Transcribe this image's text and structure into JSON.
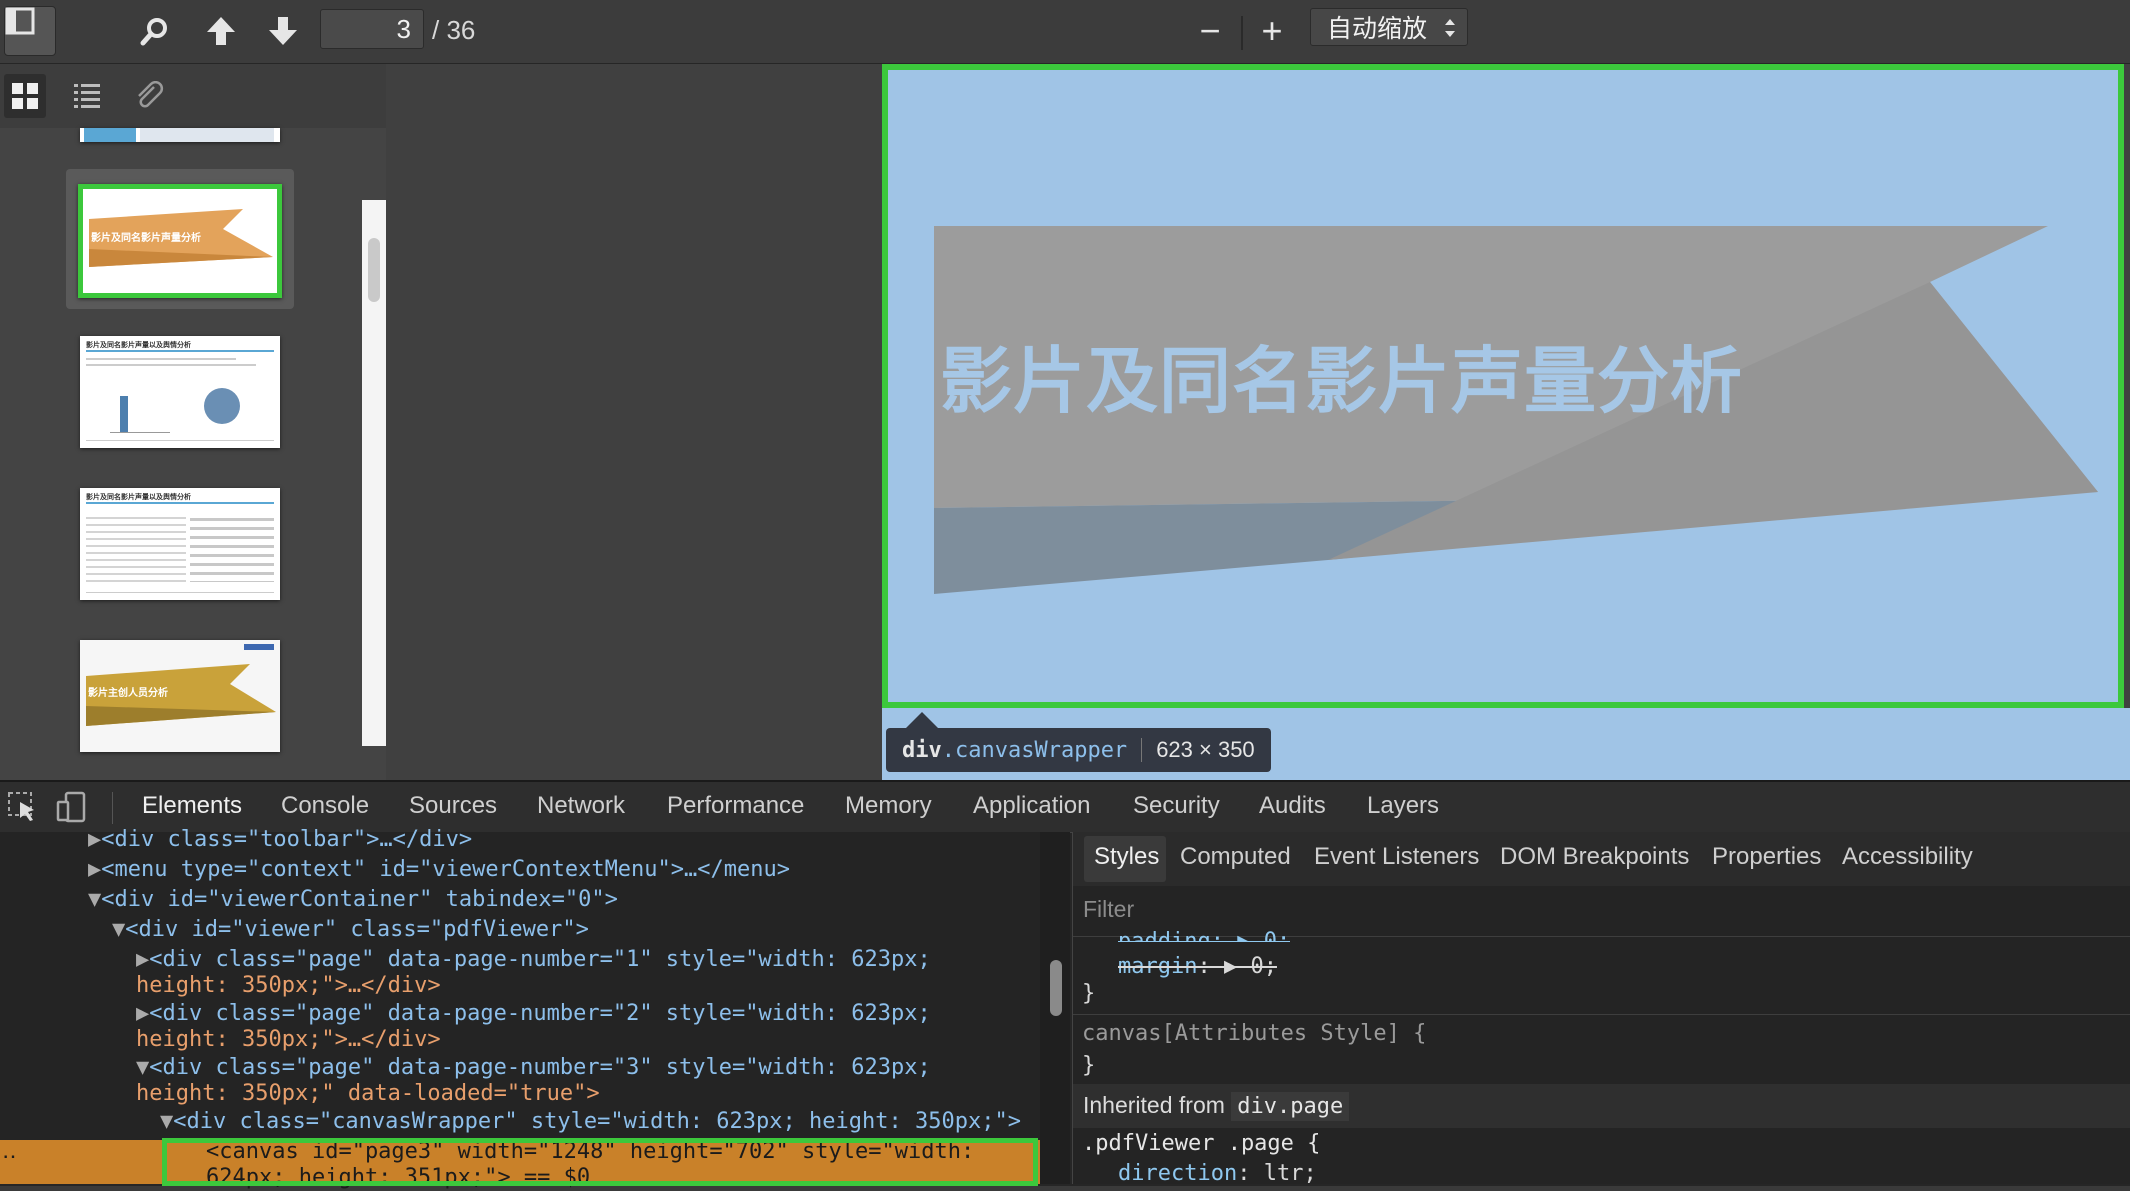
{
  "toolbar": {
    "page_number": "3",
    "page_total": "/ 36",
    "zoom_label": "自动缩放",
    "zoom_out": "−",
    "zoom_in": "+"
  },
  "thumbnails": [
    {
      "title": "影片及同名影片声量分析"
    },
    {
      "title": "影片及同名影片声量以及舆情分析"
    },
    {
      "title": "影片及同名影片声量以及舆情分析"
    },
    {
      "title": "影片主创人员分析"
    }
  ],
  "slide": {
    "title": "影片及同名影片声量分析"
  },
  "tooltip": {
    "selector_tag": "div",
    "selector_class": ".canvasWrapper",
    "size": "623 × 350"
  },
  "devtools": {
    "tabs": [
      "Elements",
      "Console",
      "Sources",
      "Network",
      "Performance",
      "Memory",
      "Application",
      "Security",
      "Audits",
      "Layers"
    ],
    "dom_lines": [
      "<div class=\"toolbar\">…</div>",
      "<menu type=\"context\" id=\"viewerContextMenu\">…</menu>",
      "<div id=\"viewerContainer\" tabindex=\"0\">",
      "<div id=\"viewer\" class=\"pdfViewer\">",
      "<div class=\"page\" data-page-number=\"1\" style=\"width: 623px;",
      "height: 350px;\">…</div>",
      "<div class=\"page\" data-page-number=\"2\" style=\"width: 623px;",
      "height: 350px;\">…</div>",
      "<div class=\"page\" data-page-number=\"3\" style=\"width: 623px;",
      "height: 350px;\" data-loaded=\"true\">",
      "<div class=\"canvasWrapper\" style=\"width: 623px; height: 350px;\">",
      "<canvas id=\"page3\" width=\"1248\" height=\"702\" style=\"width:",
      "624px; height: 351px;\"> == $0"
    ],
    "styles_tabs": [
      "Styles",
      "Computed",
      "Event Listeners",
      "DOM Breakpoints",
      "Properties",
      "Accessibility"
    ],
    "filter_placeholder": "Filter",
    "css_lines": {
      "padding": "padding: ▶ 0;",
      "margin_prop": "margin",
      "margin_val": ": ▶ 0;",
      "close1": "}",
      "attr_rule": "canvas[Attributes Style] {",
      "close2": "}",
      "inherited_label": "Inherited from",
      "inherited_selector": "div.page",
      "rule_selector": ".pdfViewer .page {",
      "direction_prop": "direction",
      "direction_val": ": ltr;"
    }
  }
}
